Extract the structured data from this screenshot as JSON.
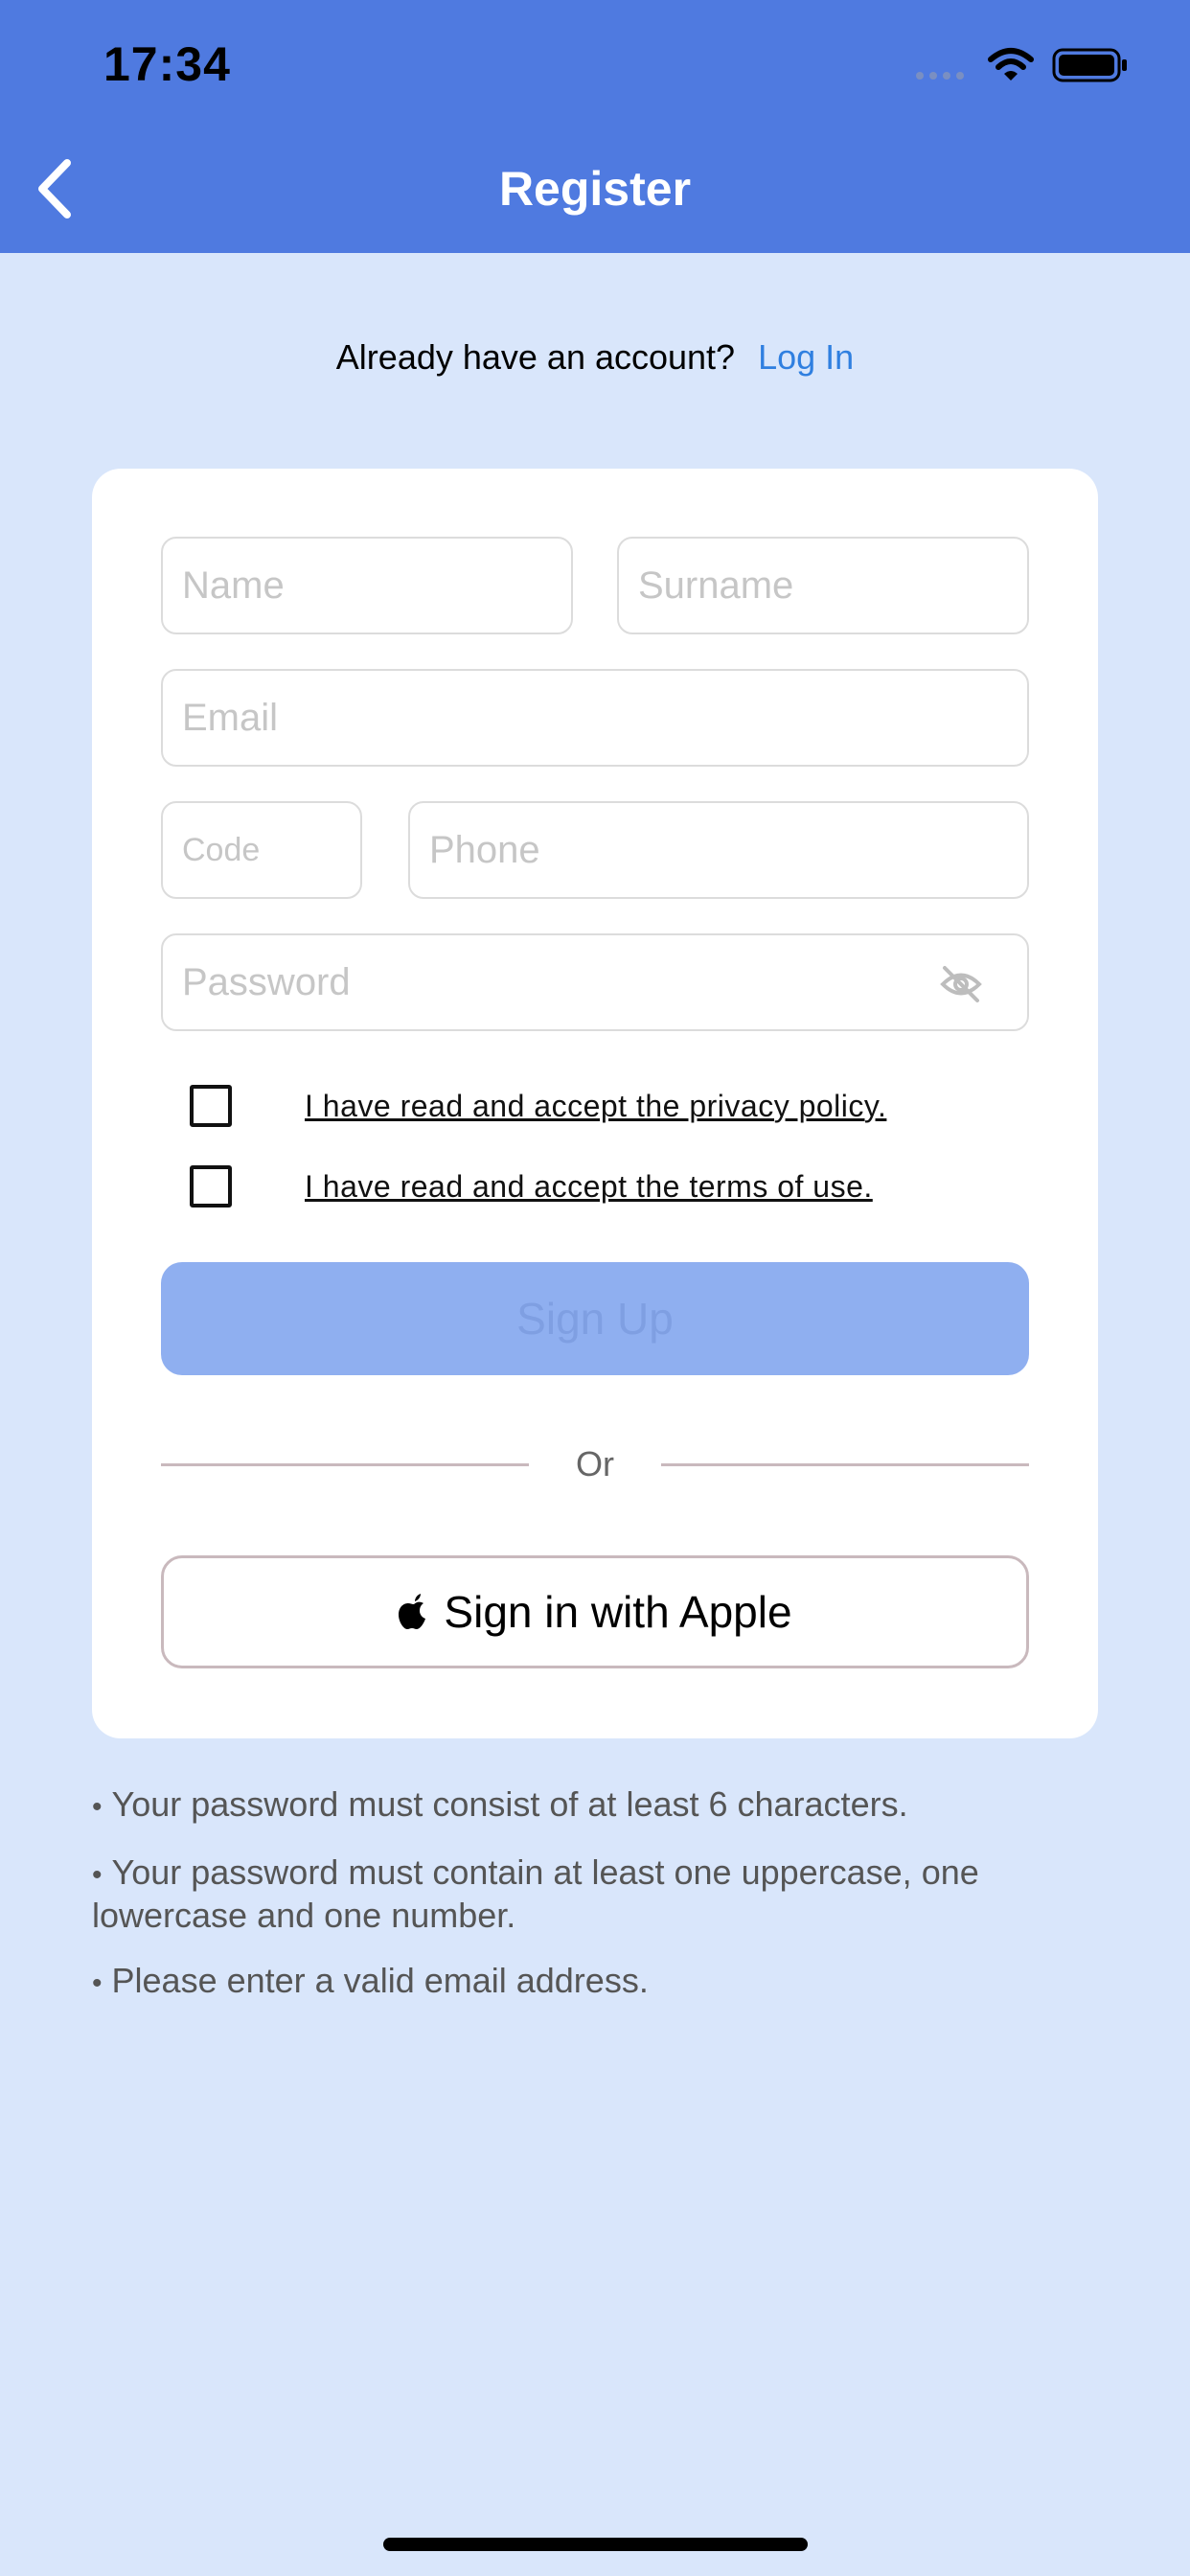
{
  "status_bar": {
    "time": "17:34"
  },
  "header": {
    "title": "Register",
    "back_icon": "chevron-left-icon"
  },
  "login_prompt": {
    "text": "Already have an account?",
    "link": "Log In"
  },
  "form": {
    "name_placeholder": "Name",
    "surname_placeholder": "Surname",
    "email_placeholder": "Email",
    "code_placeholder": "Code",
    "phone_placeholder": "Phone",
    "password_placeholder": "Password",
    "privacy_label": "I have read and accept the privacy policy.",
    "terms_label": "I have read and accept the terms of use.",
    "signup_label": "Sign Up",
    "divider_label": "Or",
    "apple_label": "Sign in with Apple"
  },
  "rules": [
    "Your password must consist of at least 6 characters.",
    "Your password must contain at least one uppercase, one lowercase and one number.",
    "Please enter a valid email address."
  ],
  "colors": {
    "header": "#4f7ae0",
    "background": "#d9e6fb",
    "link": "#2f7fe0",
    "signup_disabled": "#8faff0"
  }
}
